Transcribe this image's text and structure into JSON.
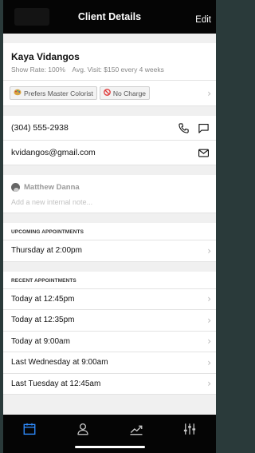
{
  "nav": {
    "title": "Client Details",
    "edit_label": "Edit"
  },
  "client": {
    "name": "Kaya Vidangos",
    "show_rate": "Show Rate: 100%",
    "avg_visit": "Avg. Visit: $150 every 4 weeks"
  },
  "tags": [
    {
      "label": "Prefers Master Colorist",
      "icon": "palette-icon"
    },
    {
      "label": "No Charge",
      "icon": "no-charge-icon"
    }
  ],
  "contact": {
    "phone": "(304) 555-2938",
    "email": "kvidangos@gmail.com"
  },
  "note": {
    "author": "Matthew Danna",
    "placeholder": "Add a new internal note..."
  },
  "upcoming": {
    "header": "UPCOMING APPOINTMENTS",
    "items": [
      "Thursday at 2:00pm"
    ]
  },
  "recent": {
    "header": "RECENT APPOINTMENTS",
    "items": [
      "Today at 12:45pm",
      "Today at 12:35pm",
      "Today at 9:00am",
      "Last Wednesday at 9:00am",
      "Last Tuesday at 12:45am"
    ]
  },
  "tabbar": {
    "items": [
      "calendar-icon",
      "person-icon",
      "chart-icon",
      "sliders-icon"
    ],
    "active_color": "#2f8cff",
    "inactive_color": "#c8c8c8"
  },
  "colors": {
    "accent": "#2f8cff",
    "no_charge_red": "#e03b3b"
  }
}
